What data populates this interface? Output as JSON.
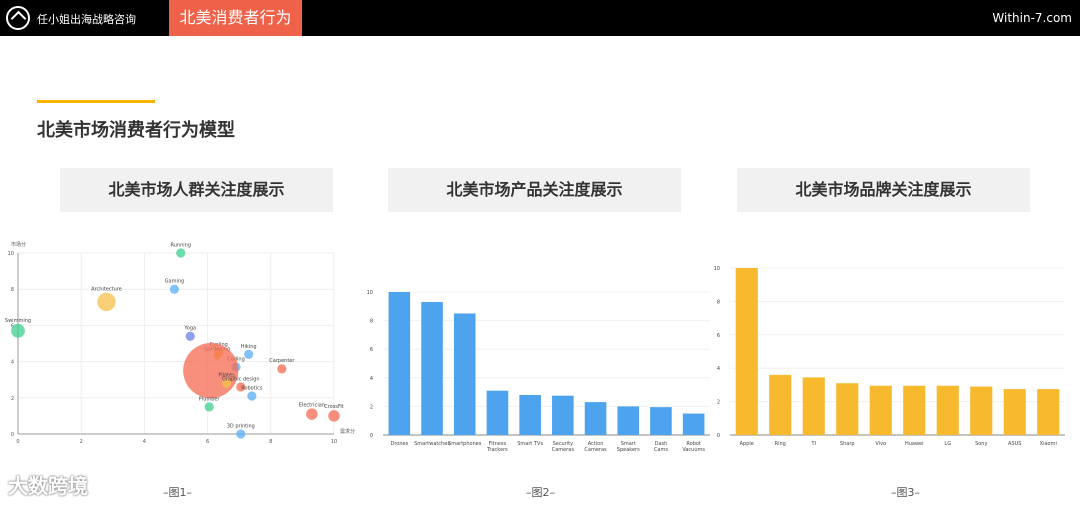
{
  "header": {
    "brand": "任小姐出海战略咨询",
    "tab": "北美消费者行为",
    "site": "Within-7.com"
  },
  "page_title": "北美市场消费者行为模型",
  "boxes": [
    "北美市场人群关注度展示",
    "北美市场产品关注度展示",
    "北美市场品牌关注度展示"
  ],
  "captions": [
    "–图1–",
    "–图2–",
    "–图3–"
  ],
  "watermark": "大数跨境",
  "chart_data": [
    {
      "type": "scatter",
      "xlabel": "需求分",
      "ylabel": "市场分",
      "xlim": [
        0,
        10
      ],
      "ylim": [
        0,
        10
      ],
      "xticks": [
        0,
        2,
        4,
        6,
        8,
        10
      ],
      "yticks": [
        0,
        2,
        4,
        6,
        8,
        10
      ],
      "points": [
        {
          "label": "Running",
          "x": 5.15,
          "y": 10,
          "size": 2,
          "color": "#3ecf8e"
        },
        {
          "label": "Gaming",
          "x": 4.95,
          "y": 8,
          "size": 2,
          "color": "#5aaef5"
        },
        {
          "label": "Architecture",
          "x": 2.8,
          "y": 7.3,
          "size": 4,
          "color": "#f7c04a"
        },
        {
          "label": "Swimming",
          "x": 0,
          "y": 5.7,
          "size": 3,
          "color": "#3ecf8e"
        },
        {
          "label": "Yoga",
          "x": 5.45,
          "y": 5.4,
          "size": 2,
          "color": "#6b7fe8"
        },
        {
          "label": "Cycling",
          "x": 6.35,
          "y": 4.5,
          "size": 2,
          "color": "#f7c04a"
        },
        {
          "label": "Gardening",
          "x": 6.3,
          "y": 4.3,
          "size": 1.5,
          "color": "#f7c04a"
        },
        {
          "label": "Hiking",
          "x": 7.3,
          "y": 4.4,
          "size": 2,
          "color": "#5aaef5"
        },
        {
          "label": "Coding",
          "x": 6.9,
          "y": 3.7,
          "size": 2,
          "color": "#5aaef5"
        },
        {
          "label": "Carpenter",
          "x": 8.35,
          "y": 3.6,
          "size": 2,
          "color": "#f56a50"
        },
        {
          "label": "",
          "x": 6.1,
          "y": 3.5,
          "size": 12,
          "color": "#f56a50"
        },
        {
          "label": "Pilates",
          "x": 6.6,
          "y": 2.8,
          "size": 2,
          "color": "#f7c04a"
        },
        {
          "label": "Graphic design",
          "x": 7.05,
          "y": 2.6,
          "size": 2,
          "color": "#f56a50"
        },
        {
          "label": "Robotics",
          "x": 7.4,
          "y": 2.1,
          "size": 2,
          "color": "#5aaef5"
        },
        {
          "label": "Plumber",
          "x": 6.05,
          "y": 1.5,
          "size": 2,
          "color": "#3ecf8e"
        },
        {
          "label": "Electrician",
          "x": 9.3,
          "y": 1.1,
          "size": 2.5,
          "color": "#f56a50"
        },
        {
          "label": "CrossFit",
          "x": 10,
          "y": 1,
          "size": 2.5,
          "color": "#f56a50"
        },
        {
          "label": "3D printing",
          "x": 7.05,
          "y": 0,
          "size": 2,
          "color": "#5aaef5"
        }
      ]
    },
    {
      "type": "bar",
      "ylim": [
        0,
        10
      ],
      "yticks": [
        0,
        2,
        4,
        6,
        8,
        10
      ],
      "color": "#4da3ee",
      "categories": [
        [
          "Drones"
        ],
        [
          "Smartwatches"
        ],
        [
          "Smartphones"
        ],
        [
          "Fitness",
          "Trackers"
        ],
        [
          "Smart TVs"
        ],
        [
          "Security",
          "Cameras"
        ],
        [
          "Action",
          "Cameras"
        ],
        [
          "Smart",
          "Speakers"
        ],
        [
          "Dash",
          "Cams"
        ],
        [
          "Robot",
          "Vacuums"
        ]
      ],
      "values": [
        10,
        9.3,
        8.5,
        3.1,
        2.8,
        2.75,
        2.3,
        2,
        1.95,
        1.5
      ]
    },
    {
      "type": "bar",
      "ylim": [
        0,
        10
      ],
      "yticks": [
        0,
        2,
        4,
        6,
        8,
        10
      ],
      "color": "#f7b92d",
      "categories": [
        [
          "Apple"
        ],
        [
          "Ring"
        ],
        [
          "TI"
        ],
        [
          "Sharp"
        ],
        [
          "Vivo"
        ],
        [
          "Huawei"
        ],
        [
          "LG"
        ],
        [
          "Sony"
        ],
        [
          "ASUS"
        ],
        [
          "Xiaomi"
        ]
      ],
      "values": [
        10,
        3.6,
        3.45,
        3.1,
        2.95,
        2.95,
        2.95,
        2.9,
        2.75,
        2.75
      ]
    }
  ]
}
